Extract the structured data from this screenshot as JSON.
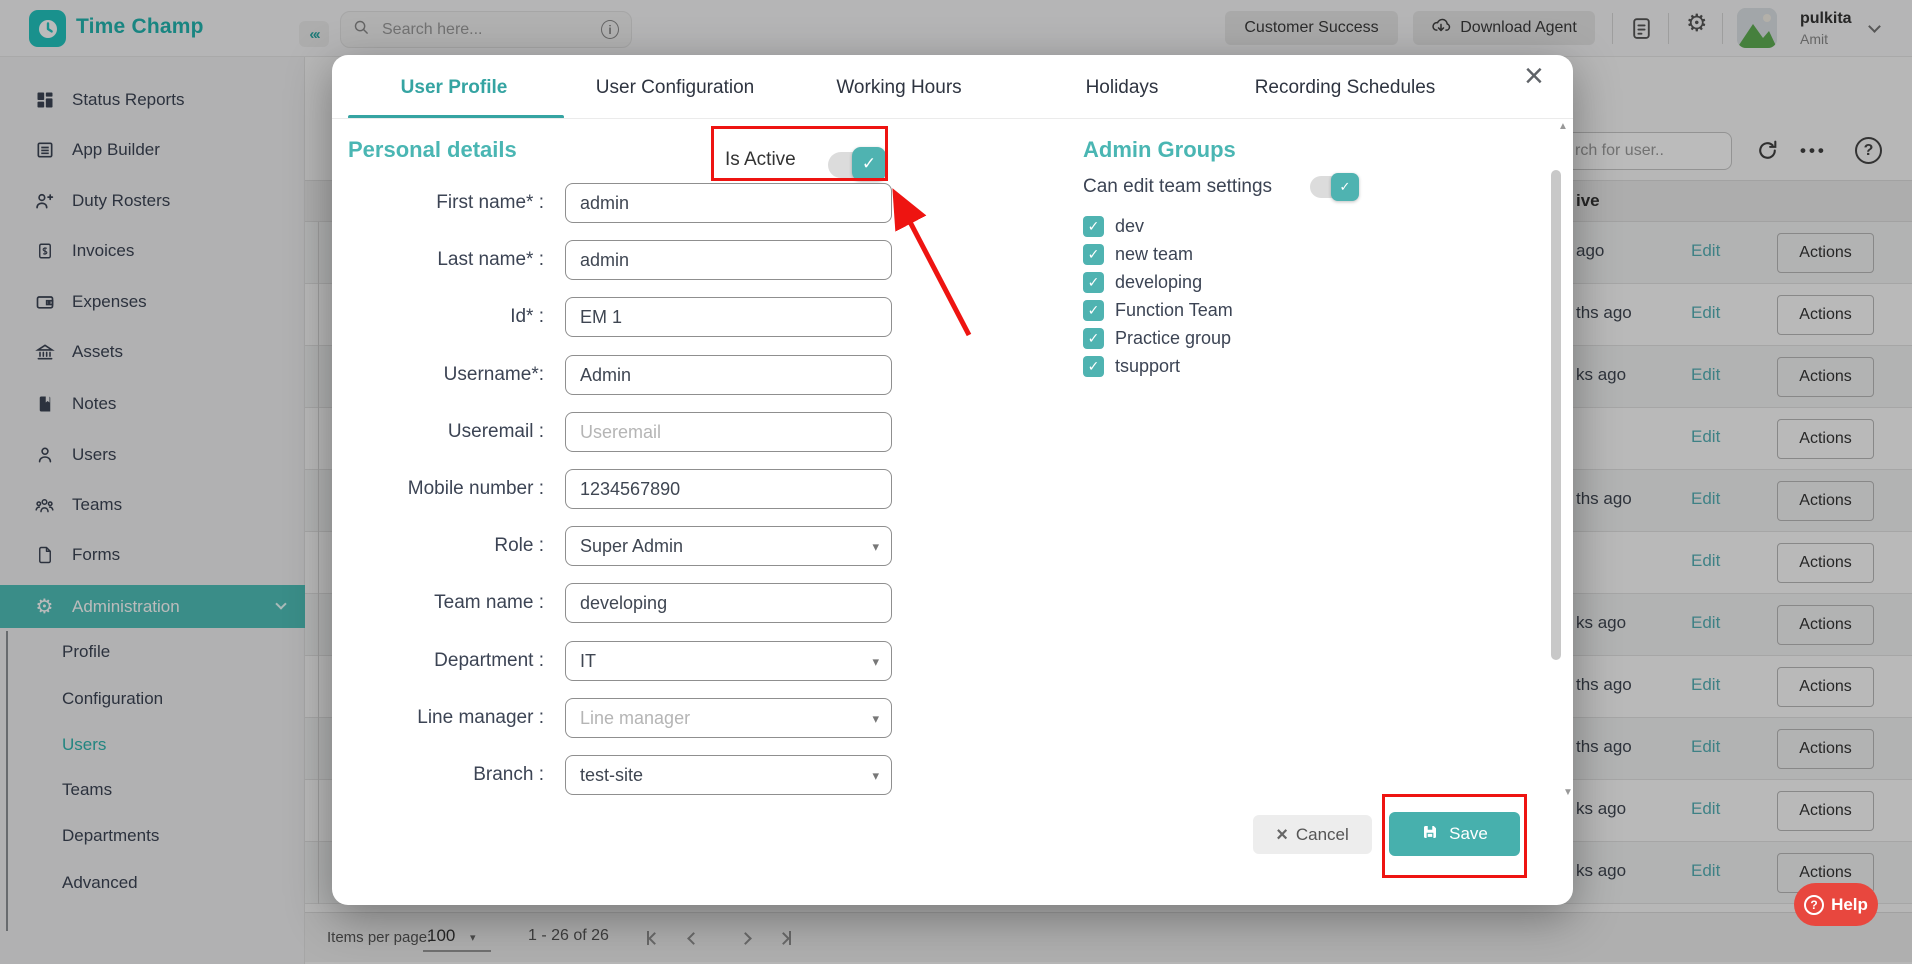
{
  "app": {
    "brand": "Time Champ"
  },
  "header": {
    "search": {
      "placeholder": "Search here..."
    },
    "customer_success_label": "Customer Success",
    "download_agent_label": "Download Agent",
    "user": {
      "name": "pulkita",
      "company": "Amit"
    }
  },
  "sidebar": {
    "items": [
      {
        "label": "Status Reports",
        "icon": "grid-icon"
      },
      {
        "label": "App Builder",
        "icon": "app-builder-icon"
      },
      {
        "label": "Duty Rosters",
        "icon": "user-plus-icon"
      },
      {
        "label": "Invoices",
        "icon": "invoice-icon"
      },
      {
        "label": "Expenses",
        "icon": "wallet-icon"
      },
      {
        "label": "Assets",
        "icon": "bank-icon"
      },
      {
        "label": "Notes",
        "icon": "notes-icon"
      },
      {
        "label": "Users",
        "icon": "user-icon"
      },
      {
        "label": "Teams",
        "icon": "team-icon"
      },
      {
        "label": "Forms",
        "icon": "form-icon"
      },
      {
        "label": "Administration",
        "icon": "gear-icon",
        "active": true,
        "expandable": true
      }
    ],
    "admin_submenu": [
      {
        "label": "Profile"
      },
      {
        "label": "Configuration"
      },
      {
        "label": "Users",
        "active": true
      },
      {
        "label": "Teams"
      },
      {
        "label": "Departments"
      },
      {
        "label": "Advanced"
      }
    ]
  },
  "modal": {
    "tabs": [
      {
        "label": "User Profile",
        "active": true
      },
      {
        "label": "User Configuration"
      },
      {
        "label": "Working Hours"
      },
      {
        "label": "Holidays"
      },
      {
        "label": "Recording Schedules"
      }
    ],
    "section_title": "Personal details",
    "is_active": {
      "label": "Is Active",
      "on": true
    },
    "fields": [
      {
        "label": "First name* :",
        "value": "admin"
      },
      {
        "label": "Last name* :",
        "value": "admin"
      },
      {
        "label": "Id* :",
        "value": "EM 1"
      },
      {
        "label": "Username*:",
        "value": "Admin"
      },
      {
        "label": "Useremail :",
        "placeholder": "Useremail"
      },
      {
        "label": "Mobile number :",
        "value": "1234567890"
      },
      {
        "label": "Role :",
        "value": "Super Admin",
        "select": true
      },
      {
        "label": "Team name :",
        "value": "developing"
      },
      {
        "label": "Department :",
        "value": "IT",
        "select": true
      },
      {
        "label": "Line manager :",
        "placeholder": "Line manager",
        "select": true
      },
      {
        "label": "Branch :",
        "value": "test-site",
        "select": true
      }
    ],
    "admin_groups": {
      "title": "Admin Groups",
      "toggle": {
        "label": "Can edit team settings",
        "on": true
      },
      "groups": [
        {
          "label": "dev",
          "checked": true
        },
        {
          "label": "new team",
          "checked": true
        },
        {
          "label": "developing",
          "checked": true
        },
        {
          "label": "Function Team",
          "checked": true
        },
        {
          "label": "Practice group",
          "checked": true
        },
        {
          "label": "tsupport",
          "checked": true
        }
      ]
    },
    "footer": {
      "cancel": "Cancel",
      "save": "Save"
    }
  },
  "content": {
    "user_search_placeholder": "rch for user..",
    "column_header": "ive",
    "row_action_edit": "Edit",
    "row_action_more": "Actions",
    "rows": [
      {
        "time": "ago"
      },
      {
        "time": "ths ago"
      },
      {
        "time": "ks ago"
      },
      {
        "time": ""
      },
      {
        "time": "ths ago"
      },
      {
        "time": ""
      },
      {
        "time": "ks ago"
      },
      {
        "time": "ths ago"
      },
      {
        "time": "ths ago"
      },
      {
        "time": "ks ago"
      },
      {
        "time": "ks ago"
      }
    ]
  },
  "pagination": {
    "label": "Items per page:",
    "value": "100",
    "range": "1 - 26 of 26"
  },
  "help": {
    "label": "Help"
  },
  "colors": {
    "teal": "#21c6c0",
    "modal_teal": "#4ab6b3",
    "annotation_red": "#ee1411",
    "help_red": "#e8473e"
  }
}
